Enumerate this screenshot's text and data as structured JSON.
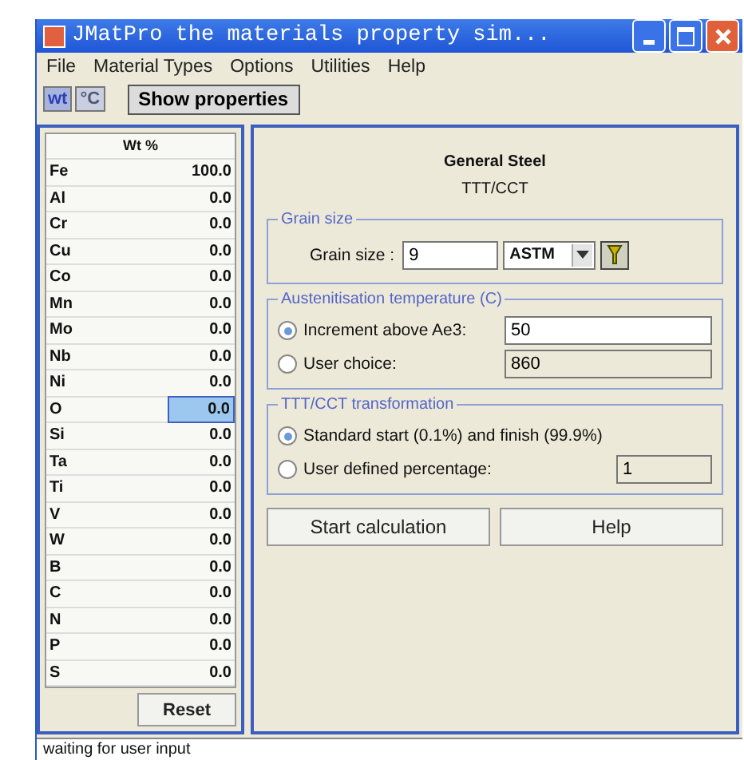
{
  "window": {
    "title": "JMatPro the materials property sim..."
  },
  "menu": [
    "File",
    "Material Types",
    "Options",
    "Utilities",
    "Help"
  ],
  "toolbar": {
    "units": [
      {
        "label": "wt",
        "selected": true
      },
      {
        "label": "°C",
        "selected": false
      }
    ],
    "show_button": "Show properties"
  },
  "composition": {
    "column": "Wt %",
    "rows": [
      {
        "element": "Fe",
        "value": "100.0",
        "selected": false
      },
      {
        "element": "Al",
        "value": "0.0",
        "selected": false
      },
      {
        "element": "Cr",
        "value": "0.0",
        "selected": false
      },
      {
        "element": "Cu",
        "value": "0.0",
        "selected": false
      },
      {
        "element": "Co",
        "value": "0.0",
        "selected": false
      },
      {
        "element": "Mn",
        "value": "0.0",
        "selected": false
      },
      {
        "element": "Mo",
        "value": "0.0",
        "selected": false
      },
      {
        "element": "Nb",
        "value": "0.0",
        "selected": false
      },
      {
        "element": "Ni",
        "value": "0.0",
        "selected": false
      },
      {
        "element": "O",
        "value": "0.0",
        "selected": true
      },
      {
        "element": "Si",
        "value": "0.0",
        "selected": false
      },
      {
        "element": "Ta",
        "value": "0.0",
        "selected": false
      },
      {
        "element": "Ti",
        "value": "0.0",
        "selected": false
      },
      {
        "element": "V",
        "value": "0.0",
        "selected": false
      },
      {
        "element": "W",
        "value": "0.0",
        "selected": false
      },
      {
        "element": "B",
        "value": "0.0",
        "selected": false
      },
      {
        "element": "C",
        "value": "0.0",
        "selected": false
      },
      {
        "element": "N",
        "value": "0.0",
        "selected": false
      },
      {
        "element": "P",
        "value": "0.0",
        "selected": false
      },
      {
        "element": "S",
        "value": "0.0",
        "selected": false
      }
    ],
    "reset_button": "Reset"
  },
  "panel": {
    "heading": "General Steel",
    "subheading": "TTT/CCT",
    "grain_size": {
      "legend": "Grain size",
      "label": "Grain size :",
      "value": "9",
      "unit": "ASTM"
    },
    "austenitisation": {
      "legend": "Austenitisation temperature (C)",
      "options": [
        {
          "label": "Increment above Ae3:",
          "value": "50",
          "selected": true
        },
        {
          "label": "User choice:",
          "value": "860",
          "selected": false
        }
      ]
    },
    "transformation": {
      "legend": "TTT/CCT transformation",
      "options": [
        {
          "label": "Standard start (0.1%) and finish (99.9%)",
          "selected": true
        },
        {
          "label": "User defined percentage:",
          "value": "1",
          "selected": false
        }
      ]
    },
    "buttons": [
      "Start calculation",
      "Help"
    ]
  },
  "status_bar": "waiting for user input"
}
